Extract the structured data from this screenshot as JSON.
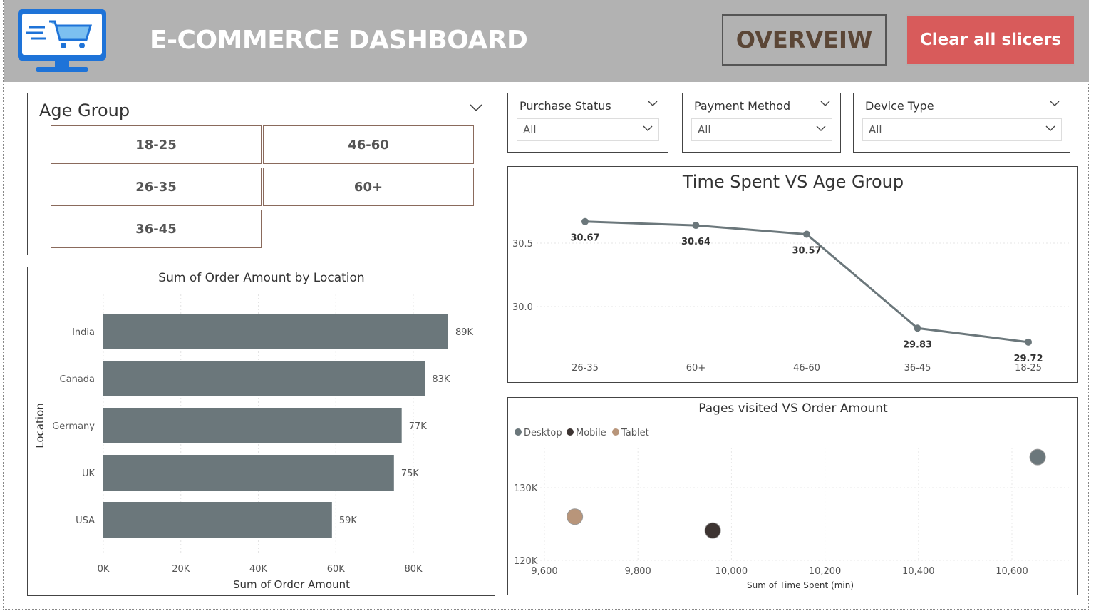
{
  "header": {
    "title": "E-COMMERCE DASHBOARD",
    "logo_icon": "shopping-cart-monitor-icon",
    "overview_label": "OVERVEIW",
    "clear_label": "Clear all slicers"
  },
  "colors": {
    "header_bg": "#b2b2b2",
    "clear_button": "#d85b5b",
    "overview_text": "#5b4636",
    "bar": "#6b777b",
    "line": "#6b777b",
    "desktop": "#6b777b",
    "mobile": "#3d3432",
    "tablet": "#b8957a"
  },
  "age_slicer": {
    "title": "Age Group",
    "options": [
      "18-25",
      "46-60",
      "26-35",
      "60+",
      "36-45"
    ]
  },
  "slicers": [
    {
      "title": "Purchase Status",
      "value": "All"
    },
    {
      "title": "Payment Method",
      "value": "All"
    },
    {
      "title": "Device Type",
      "value": "All"
    }
  ],
  "chart_data": [
    {
      "type": "bar",
      "orientation": "horizontal",
      "title": "Sum of Order Amount by Location",
      "xlabel": "Sum of Order Amount",
      "ylabel": "Location",
      "categories": [
        "India",
        "Canada",
        "Germany",
        "UK",
        "USA"
      ],
      "values": [
        89000,
        83000,
        77000,
        75000,
        59000
      ],
      "data_labels": [
        "89K",
        "83K",
        "77K",
        "75K",
        "59K"
      ],
      "xticks": [
        "0K",
        "20K",
        "40K",
        "60K",
        "80K"
      ],
      "xlim": [
        0,
        95000
      ],
      "grid": true
    },
    {
      "type": "line",
      "title": "Time Spent VS Age Group",
      "categories": [
        "26-35",
        "60+",
        "46-60",
        "36-45",
        "18-25"
      ],
      "values": [
        30.67,
        30.64,
        30.57,
        29.83,
        29.72
      ],
      "data_labels": [
        "30.67",
        "30.64",
        "30.57",
        "29.83",
        "29.72"
      ],
      "yticks": [
        "30.5",
        "30.0"
      ],
      "ylim": [
        29.5,
        30.9
      ],
      "grid": true
    },
    {
      "type": "scatter",
      "title": "Pages visited VS Order Amount",
      "xlabel": "Sum of Time Spent (min)",
      "legend": [
        "Desktop",
        "Mobile",
        "Tablet"
      ],
      "legend_position": "top-left",
      "series": [
        {
          "name": "Desktop",
          "x": 10655,
          "y": 134200
        },
        {
          "name": "Mobile",
          "x": 9960,
          "y": 124100
        },
        {
          "name": "Tablet",
          "x": 9665,
          "y": 126000
        }
      ],
      "xticks": [
        "9,600",
        "9,800",
        "10,000",
        "10,200",
        "10,400",
        "10,600"
      ],
      "yticks": [
        "130K",
        "120K"
      ],
      "xlim": [
        9600,
        10700
      ],
      "ylim": [
        120000,
        137000
      ],
      "grid": true
    }
  ]
}
